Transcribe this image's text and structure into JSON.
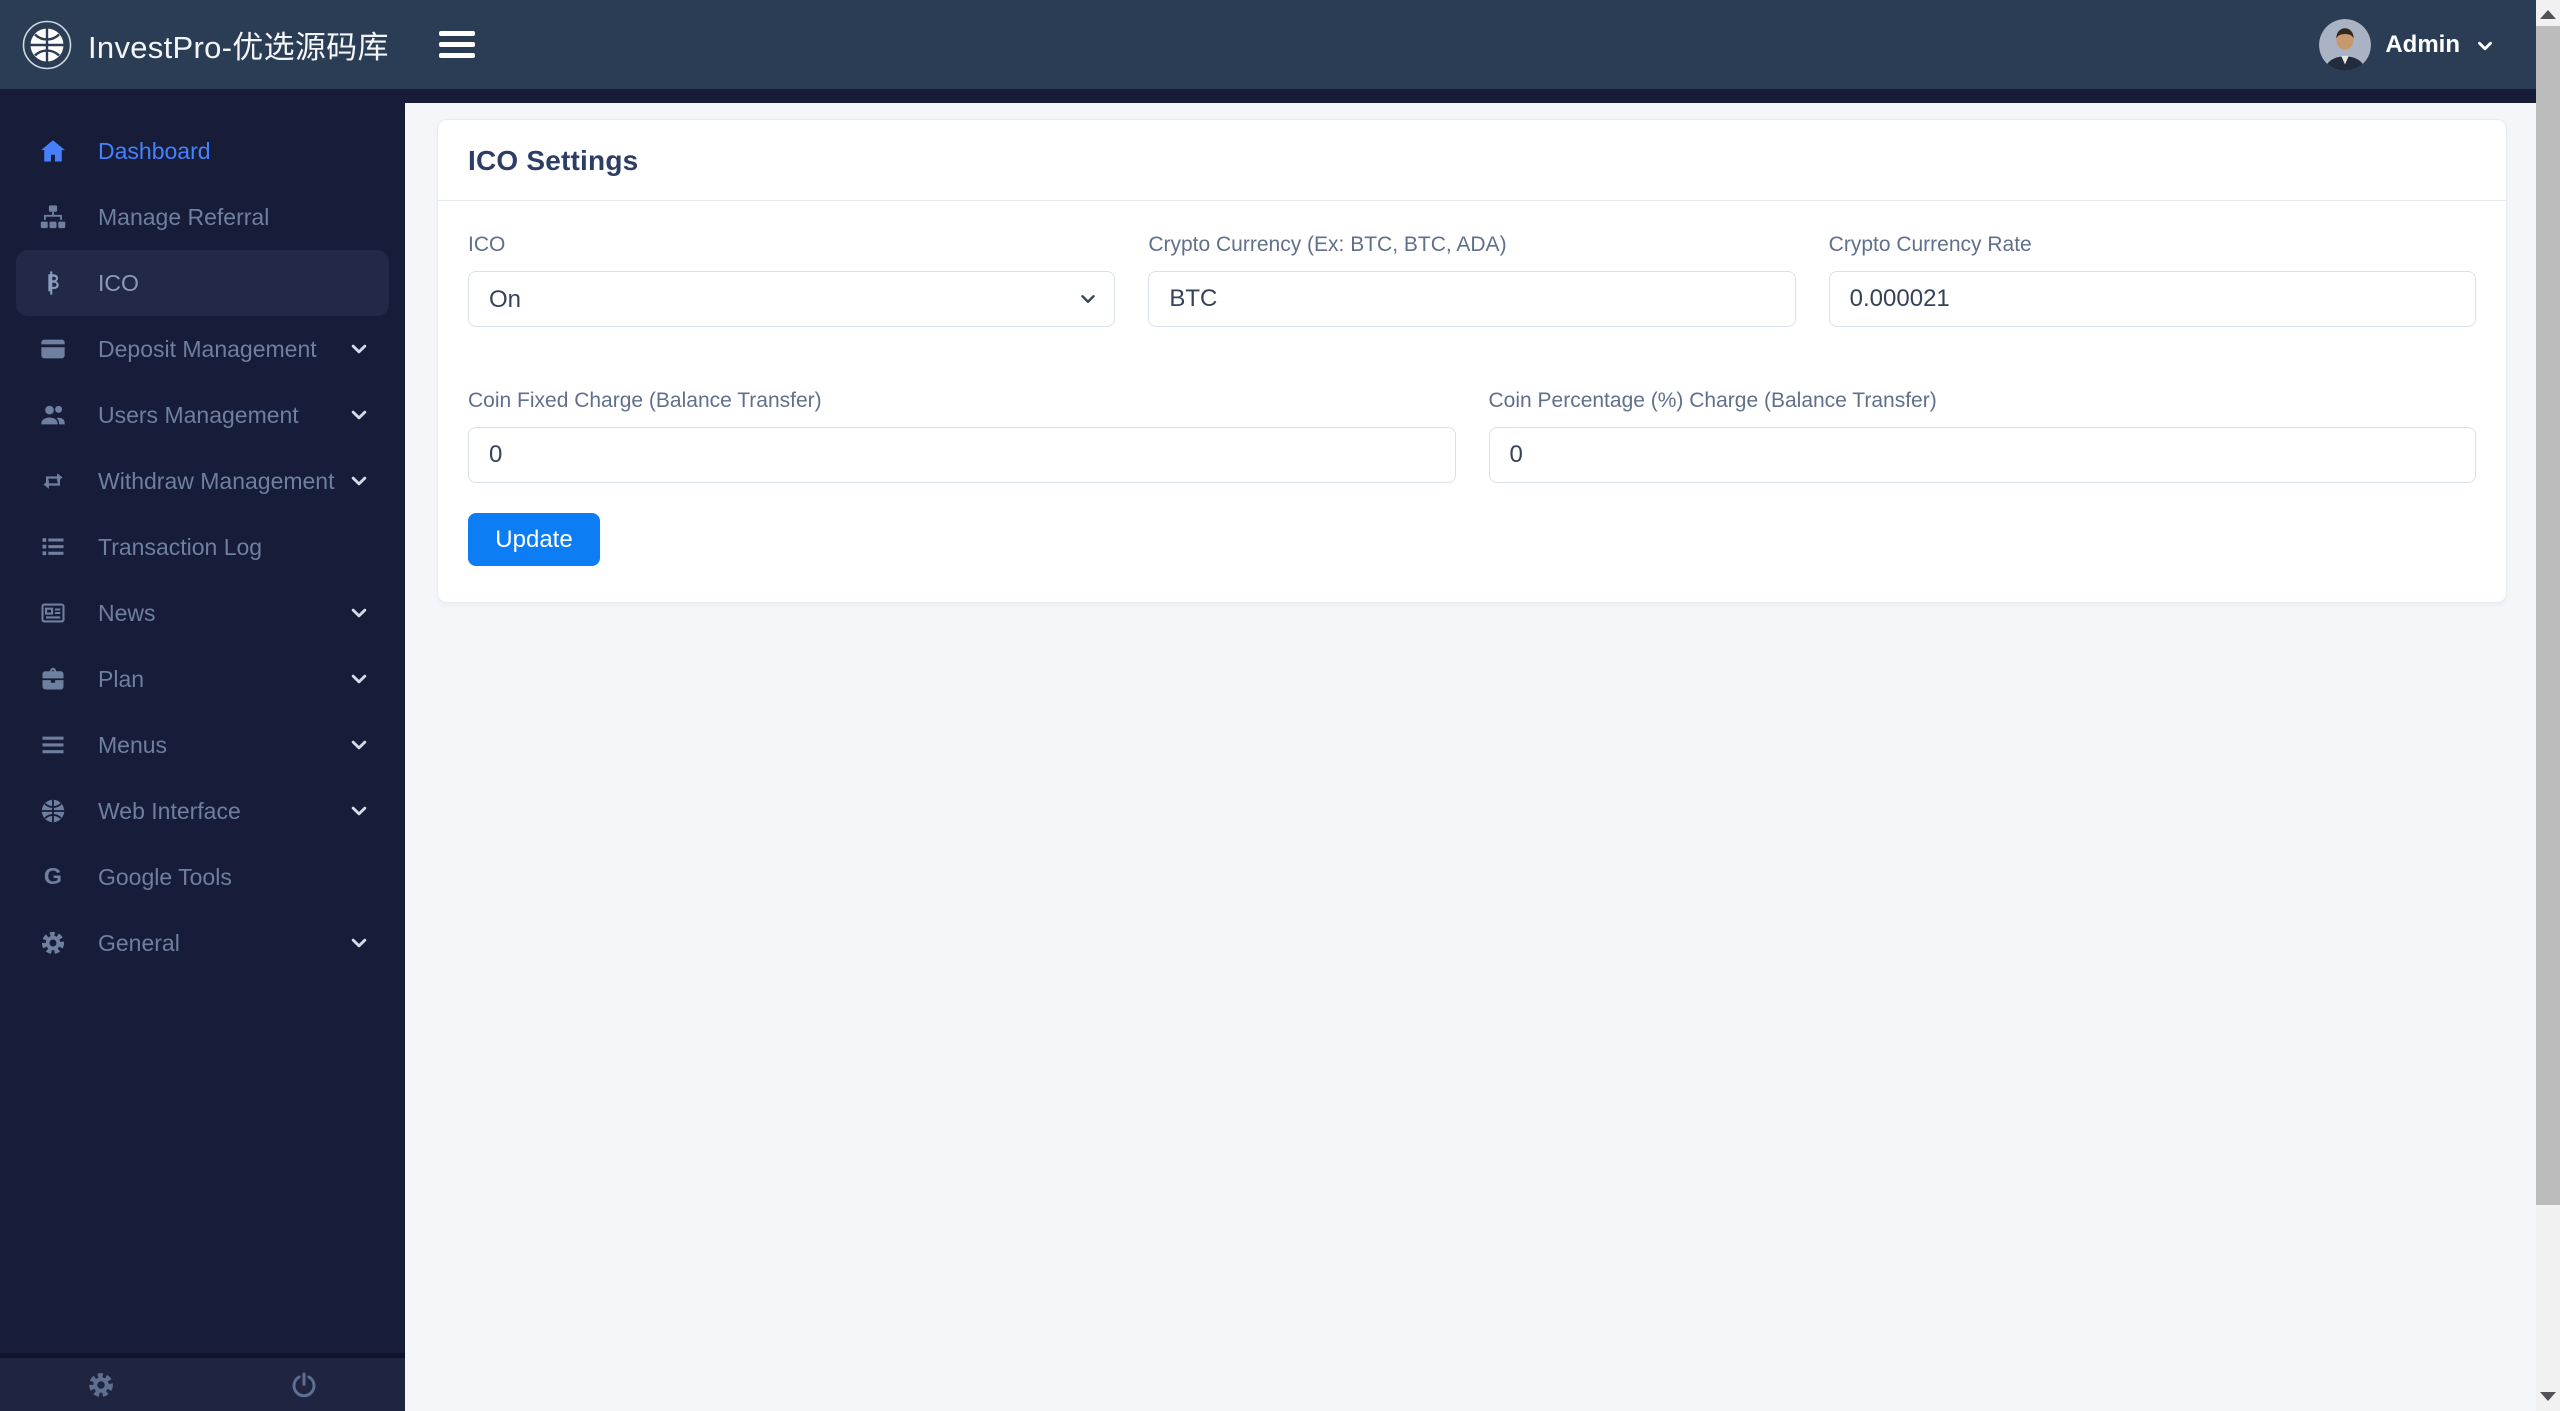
{
  "app": {
    "brand": "InvestPro-优选源码库"
  },
  "topbar": {
    "user_name": "Admin"
  },
  "sidebar": {
    "items": [
      {
        "label": "Dashboard"
      },
      {
        "label": "Manage Referral"
      },
      {
        "label": "ICO"
      },
      {
        "label": "Deposit Management"
      },
      {
        "label": "Users Management"
      },
      {
        "label": "Withdraw Management"
      },
      {
        "label": "Transaction Log"
      },
      {
        "label": "News"
      },
      {
        "label": "Plan"
      },
      {
        "label": "Menus"
      },
      {
        "label": "Web Interface"
      },
      {
        "label": "Google Tools"
      },
      {
        "label": "General"
      }
    ]
  },
  "page": {
    "card_title": "ICO Settings",
    "fields": {
      "ico": {
        "label": "ICO",
        "value": "On"
      },
      "crypto_currency": {
        "label": "Crypto Currency (Ex: BTC, BTC, ADA)",
        "value": "BTC"
      },
      "crypto_rate": {
        "label": "Crypto Currency Rate",
        "value": "0.000021"
      },
      "coin_fixed": {
        "label": "Coin Fixed Charge (Balance Transfer)",
        "value": "0"
      },
      "coin_percent": {
        "label": "Coin Percentage (%) Charge (Balance Transfer)",
        "value": "0"
      }
    },
    "update_button": "Update"
  },
  "colors": {
    "topbar": "#2b3d54",
    "sidebar": "#171d38",
    "accent": "#4680ff",
    "primary_button": "#0d7df5",
    "content_bg": "#f4f6f9"
  }
}
